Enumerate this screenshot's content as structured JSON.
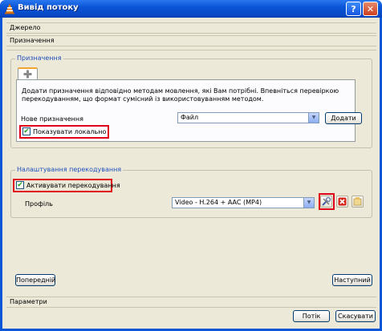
{
  "window": {
    "title": "Вивід потоку"
  },
  "sections": {
    "source": "Джерело",
    "destination": "Призначення",
    "options": "Параметри"
  },
  "destination_group": {
    "legend": "Призначення",
    "tab_icon": "plus-icon",
    "description": "Додати призначення відповідно методам мовлення, які Вам потрібні. Впевніться перевіркою перекодуванням, що формат сумісний із використовуванням методом.",
    "new_dest_label": "Нове призначення",
    "new_dest_value": "Файл",
    "add_button": "Додати",
    "show_local_label": "Показувати локально",
    "show_local_checked": true
  },
  "transcode_group": {
    "legend": "Налаштування перекодування",
    "activate_label": "Активувати перекодування",
    "activate_checked": true,
    "profile_label": "Профіль",
    "profile_value": "Video - H.264 + AAC (MP4)",
    "edit_icon": "tools-icon",
    "delete_icon": "delete-icon",
    "new_icon": "new-profile-icon"
  },
  "buttons": {
    "back": "Попередній",
    "next": "Наступний",
    "stream": "Потік",
    "cancel": "Скасувати"
  },
  "colors": {
    "highlight": "#e0001a",
    "title_bar": "#0a55d6",
    "legend": "#1e4fbe"
  }
}
